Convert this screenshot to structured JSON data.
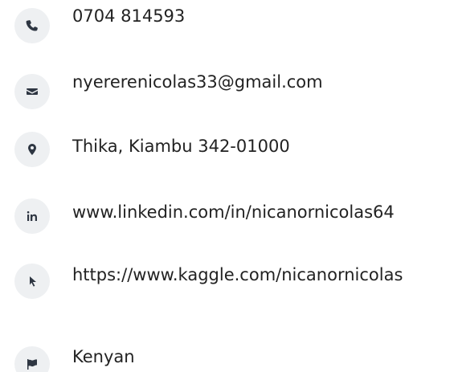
{
  "contact_items": [
    {
      "icon": "phone-icon",
      "text": "0704 814593"
    },
    {
      "icon": "envelope-icon",
      "text": "nyererenicolas33@gmail.com"
    },
    {
      "icon": "location-pin-icon",
      "text": "Thika, Kiambu 342-01000"
    },
    {
      "icon": "linkedin-icon",
      "text": "www.linkedin.com/in/nicanornicolas64"
    },
    {
      "icon": "cursor-pointer-icon",
      "text": "https://www.kaggle.com/nicanornicolas"
    },
    {
      "icon": "flag-icon",
      "text": "Kenyan"
    }
  ],
  "colors": {
    "icon_background": "#eef0f2",
    "icon_foreground": "#2e3642",
    "text": "#222222"
  }
}
